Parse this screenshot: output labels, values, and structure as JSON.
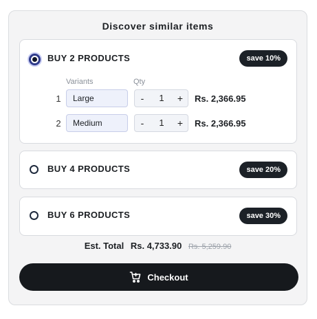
{
  "widget": {
    "title": "Discover similar items",
    "bundles": [
      {
        "label": "BUY 2 PRODUCTS",
        "badge": "save 10%",
        "selected": true
      },
      {
        "label": "BUY 4 PRODUCTS",
        "badge": "save 20%",
        "selected": false
      },
      {
        "label": "BUY 6 PRODUCTS",
        "badge": "save 30%",
        "selected": false
      }
    ],
    "columns": {
      "variants": "Variants",
      "qty": "Qty"
    },
    "items": [
      {
        "index": "1",
        "variant": "Large",
        "qty": "1",
        "price": "Rs. 2,366.95"
      },
      {
        "index": "2",
        "variant": "Medium",
        "qty": "1",
        "price": "Rs. 2,366.95"
      }
    ],
    "stepper": {
      "minus": "-",
      "plus": "+"
    },
    "total": {
      "label": "Est. Total",
      "value": "Rs. 4,733.90",
      "original": "Rs. 5,259.90"
    },
    "checkout": {
      "label": "Checkout",
      "icon": "cart-icon"
    }
  },
  "colors": {
    "accent": "#16191d",
    "badge_bg": "#1c2127",
    "radio_selected": "#2e3a8a",
    "panel_bg": "#f4f4f5"
  }
}
